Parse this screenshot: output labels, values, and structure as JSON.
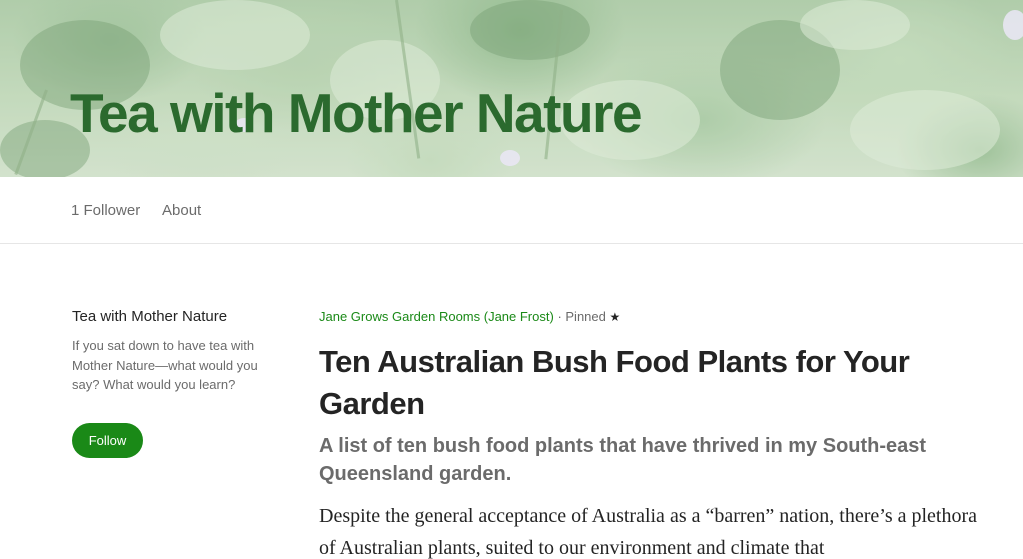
{
  "publication": {
    "title": "Tea with Mother Nature"
  },
  "subnav": {
    "followers": "1 Follower",
    "about": "About"
  },
  "sidebar": {
    "title": "Tea with Mother Nature",
    "description": "If you sat down to have tea with Mother Nature—what would you say? What would you learn?",
    "follow_label": "Follow"
  },
  "article": {
    "author": "Jane Grows Garden Rooms (Jane Frost)",
    "separator": "·",
    "pinned": "Pinned",
    "star_icon": "★",
    "title": "Ten Australian Bush Food Plants for Your Garden",
    "subtitle": "A list of ten bush food plants that have thrived in my South-east Queensland garden.",
    "body": "Despite the general acceptance of Australia as a “barren” nation, there’s a plethora of Australian plants, suited to our environment and climate that"
  },
  "colors": {
    "brand_green": "#2b6a2e",
    "follow_green": "#1a8917"
  }
}
